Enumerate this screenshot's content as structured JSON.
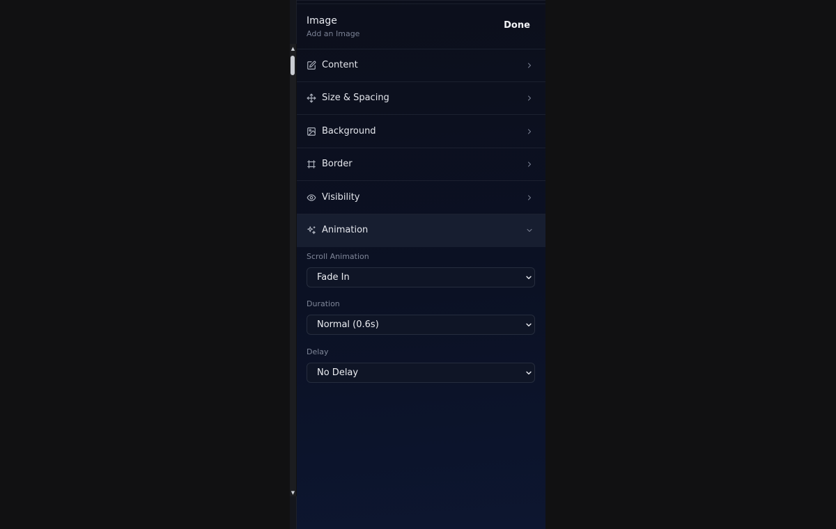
{
  "header": {
    "title": "Image",
    "subtitle": "Add an Image",
    "done_label": "Done"
  },
  "sections": [
    {
      "label": "Content",
      "icon": "edit-icon",
      "expanded": false
    },
    {
      "label": "Size & Spacing",
      "icon": "move-icon",
      "expanded": false
    },
    {
      "label": "Background",
      "icon": "image-icon",
      "expanded": false
    },
    {
      "label": "Border",
      "icon": "hash-icon",
      "expanded": false
    },
    {
      "label": "Visibility",
      "icon": "eye-icon",
      "expanded": false
    },
    {
      "label": "Animation",
      "icon": "sparkles-icon",
      "expanded": true
    }
  ],
  "animation": {
    "scroll_animation": {
      "label": "Scroll Animation",
      "value": "Fade In"
    },
    "duration": {
      "label": "Duration",
      "value": "Normal (0.6s)"
    },
    "delay": {
      "label": "Delay",
      "value": "No Delay"
    }
  },
  "colors": {
    "page_bg": "#111112",
    "panel_bg": "#0b1124",
    "active_section_bg": "#171e30",
    "text": "#e4e6ec",
    "muted_text": "#7f8698"
  }
}
